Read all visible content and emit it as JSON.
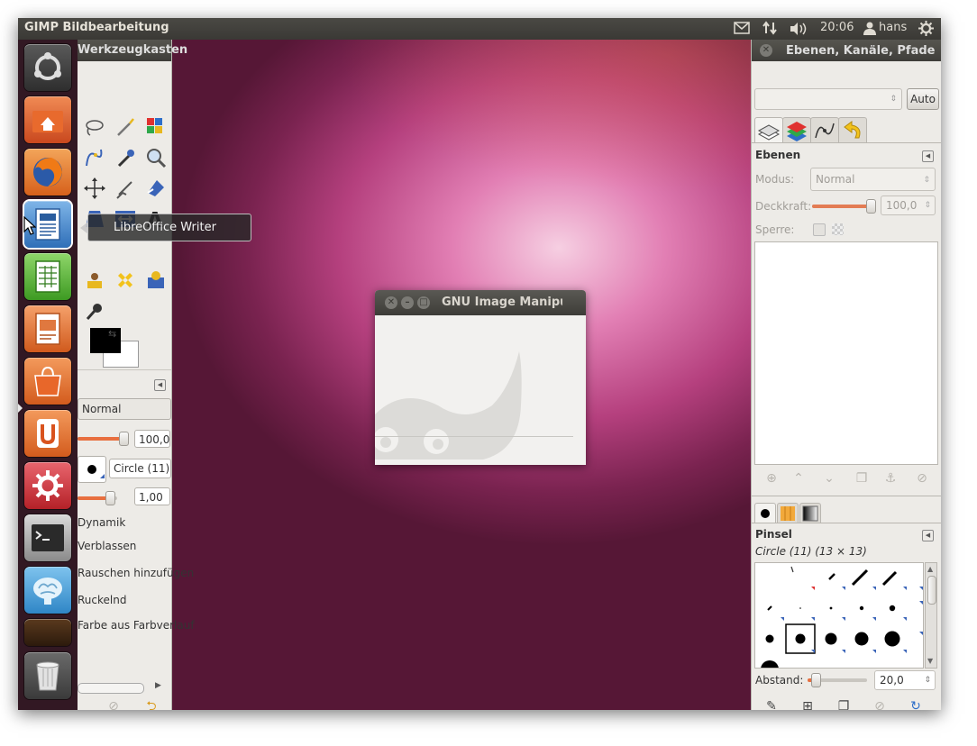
{
  "panel": {
    "app_title": "GIMP Bildbearbeitung",
    "time": "20:06",
    "user": "hans",
    "icons": [
      "mail-icon",
      "network-icon",
      "volume-icon",
      "user-icon",
      "power-gear-icon"
    ]
  },
  "launcher": {
    "tooltip": "LibreOffice Writer",
    "items": [
      "ubuntu-dash",
      "home-folder",
      "firefox",
      "libreoffice-writer",
      "libreoffice-calc",
      "libreoffice-impress",
      "software-center",
      "ubuntu-one",
      "system-settings",
      "terminal",
      "brain-app",
      "workspace-switcher",
      "trash"
    ]
  },
  "toolbox": {
    "title": "Werkzeugkasten",
    "mode_value": "Normal",
    "opacity_value": "100,0",
    "brush_value": "Circle (11)",
    "size_value": "1,00",
    "options": [
      "Dynamik",
      "Verblassen",
      "Rauschen hinzufügen",
      "Ruckelnd",
      "Farbe aus Farbverlauf"
    ]
  },
  "dock": {
    "title": "Ebenen, Kanäle, Pfade",
    "auto_button": "Auto",
    "layers_header": "Ebenen",
    "mode_label": "Modus:",
    "mode_value": "Normal",
    "opacity_label": "Deckkraft:",
    "opacity_value": "100,0",
    "lock_label": "Sperre:",
    "brushes_header": "Pinsel",
    "brush_info": "Circle (11) (13 × 13)",
    "spacing_label": "Abstand:",
    "spacing_value": "20,0",
    "opacity_fraction": 1.0,
    "spacing_fraction": 0.2
  },
  "splash": {
    "title": "GNU Image Manipulation Program"
  },
  "colors": {
    "accent_orange": "#e86f3f",
    "panel_bg": "#3c3b37",
    "dock_bg": "#edebe7"
  }
}
